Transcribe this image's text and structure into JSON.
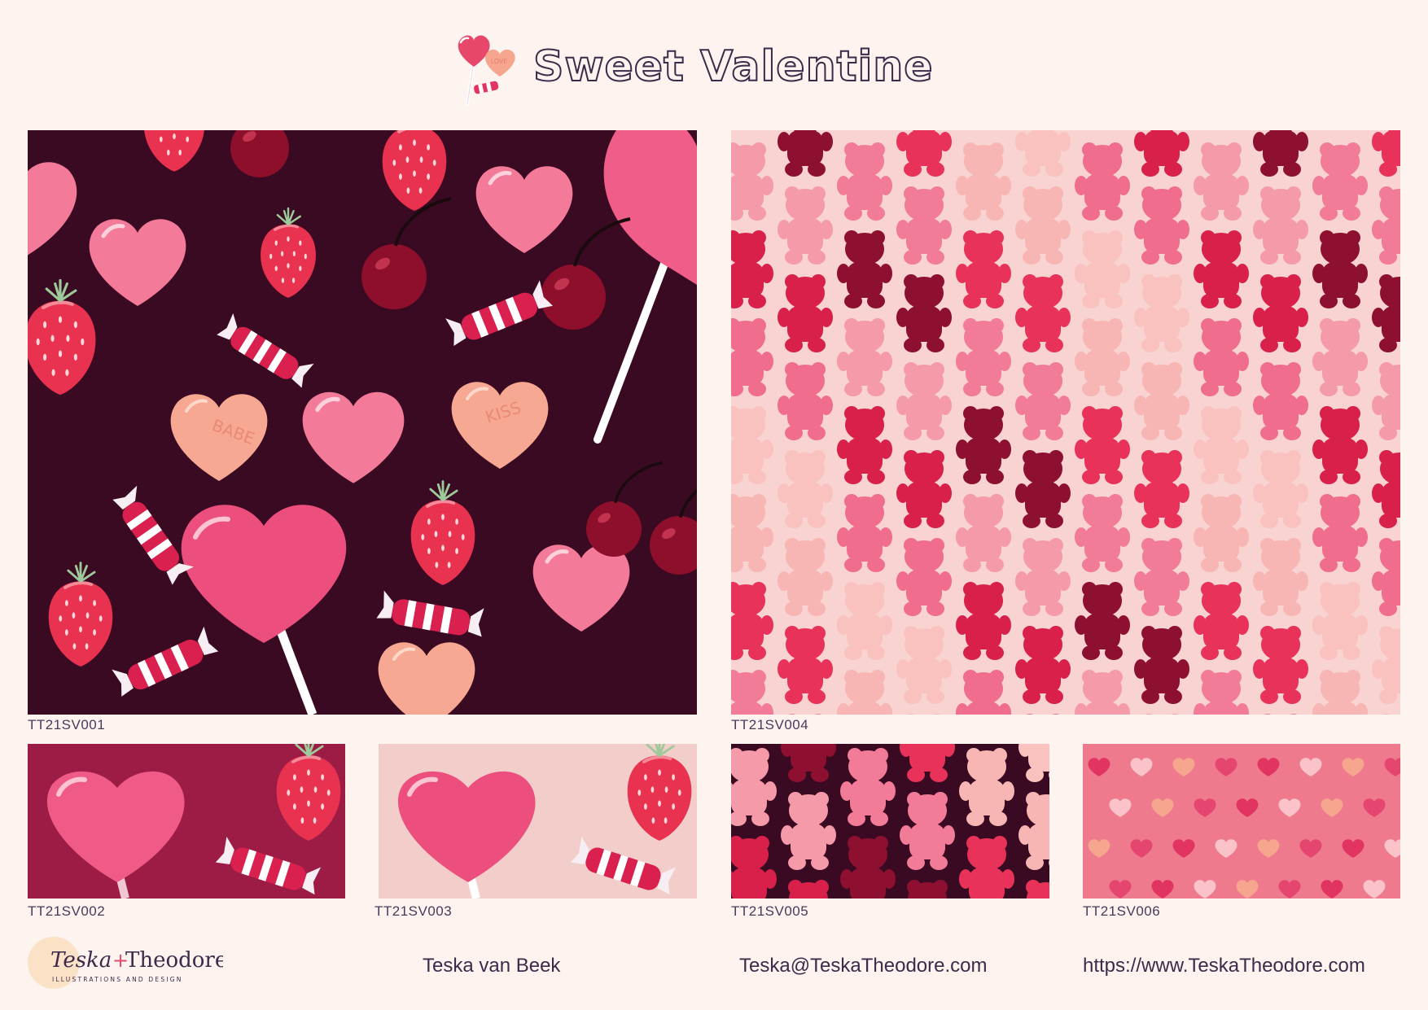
{
  "header": {
    "title": "Sweet Valentine",
    "icon": "lollipop-and-candy-heart-icon",
    "love_text": "LOVE"
  },
  "patterns": [
    {
      "code": "TT21SV001",
      "background": "#3a0a22"
    },
    {
      "code": "TT21SV002",
      "background": "#9c1c45"
    },
    {
      "code": "TT21SV003",
      "background": "#f3cdc9"
    },
    {
      "code": "TT21SV004",
      "background": "#f8d3d1"
    },
    {
      "code": "TT21SV005",
      "background": "#3a0a22"
    },
    {
      "code": "TT21SV006",
      "background": "#ef7a8e"
    }
  ],
  "candy_hearts": {
    "babe": "BABE",
    "kiss": "KISS"
  },
  "footer": {
    "logo_name_1": "Teska",
    "logo_plus": "+",
    "logo_name_2": "Theodore",
    "logo_tagline": "ILLUSTRATIONS AND DESIGN",
    "author": "Teska van Beek",
    "email": "Teska@TeskaTheodore.com",
    "website": "https://www.TeskaTheodore.com"
  },
  "colors": {
    "page_background": "#fdf3ef",
    "text": "#3d2a4a",
    "logo_circle": "#fbe2c6"
  }
}
